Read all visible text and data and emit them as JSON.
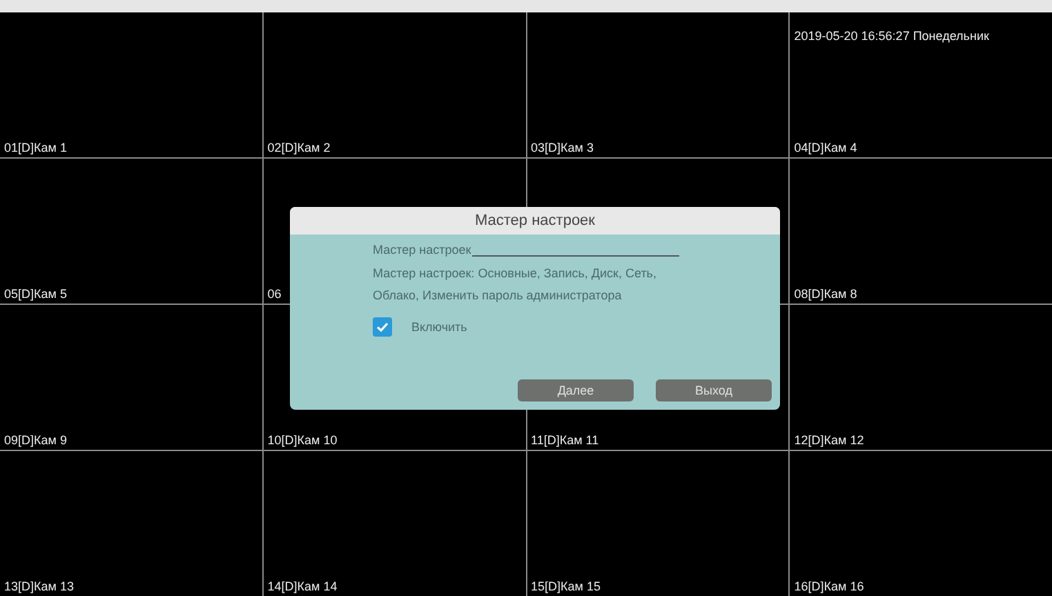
{
  "cameras": [
    {
      "label": "01[D]Кам 1"
    },
    {
      "label": "02[D]Кам 2"
    },
    {
      "label": "03[D]Кам 3"
    },
    {
      "label": "04[D]Кам 4",
      "overlay": "2019-05-20 16:56:27 Понедельник"
    },
    {
      "label": "05[D]Кам 5"
    },
    {
      "label": "06"
    },
    {
      "kind": "covered"
    },
    {
      "label": "08[D]Кам 8"
    },
    {
      "label": "09[D]Кам 9"
    },
    {
      "label": "10[D]Кам 10"
    },
    {
      "label": "11[D]Кам 11"
    },
    {
      "label": "12[D]Кам 12"
    },
    {
      "label": "13[D]Кам 13"
    },
    {
      "label": "14[D]Кам 14"
    },
    {
      "label": "15[D]Кам 15"
    },
    {
      "label": "16[D]Кам 16"
    }
  ],
  "dialog": {
    "title": "Мастер настроек",
    "heading": "Мастер настроек",
    "description": "Мастер настроек: Основные, Запись, Диск, Сеть, Облако, Изменить пароль администратора",
    "checkbox": {
      "label": "Включить",
      "checked": true
    },
    "buttons": [
      "Далее",
      "Выход"
    ]
  }
}
